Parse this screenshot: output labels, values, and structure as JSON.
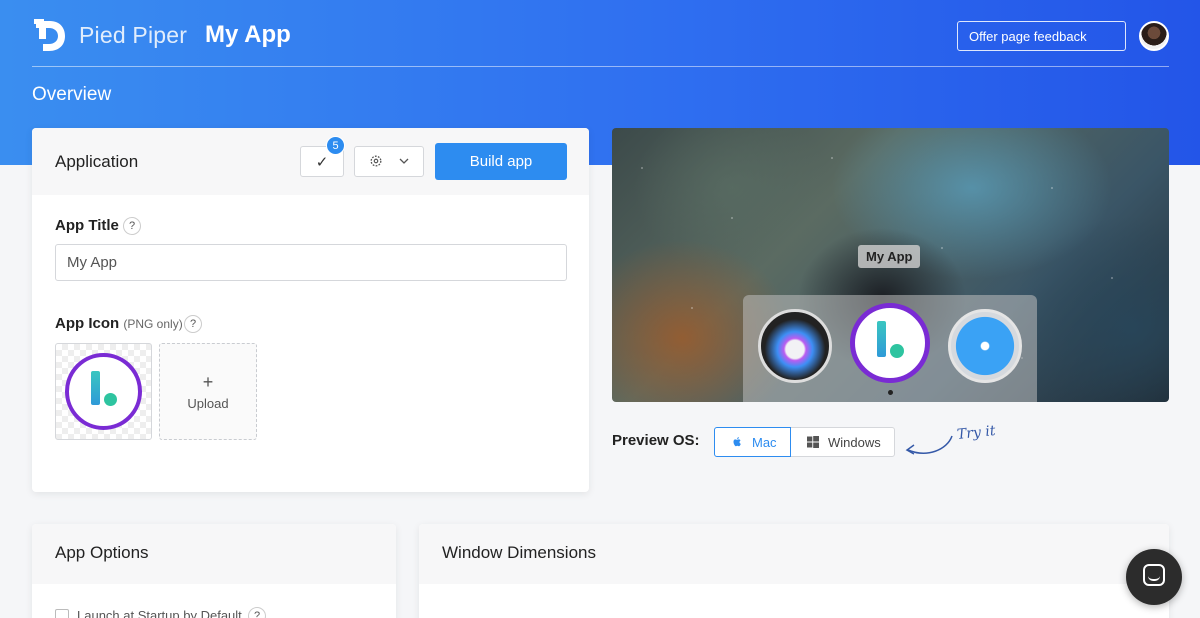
{
  "header": {
    "brand": "Pied Piper",
    "app_name": "My App",
    "feedback_label": "Offer page feedback",
    "page_title": "Overview"
  },
  "application_card": {
    "title": "Application",
    "check_count": "5",
    "build_label": "Build app",
    "app_title_label": "App Title",
    "app_title_value": "My App",
    "app_icon_label": "App Icon",
    "app_icon_hint": "(PNG only)",
    "help": "?",
    "upload_plus": "+",
    "upload_label": "Upload"
  },
  "preview": {
    "tooltip": "My App",
    "label": "Preview OS:",
    "os_options": [
      "Mac",
      "Windows"
    ],
    "selected_os": "Mac",
    "try_it": "Try it"
  },
  "options_card": {
    "title": "App Options",
    "startup_label": "Launch at Startup by Default",
    "help": "?"
  },
  "window_card": {
    "title": "Window Dimensions"
  },
  "colors": {
    "primary": "#2d8cf0",
    "brand_gradient": [
      "#3a8ef0",
      "#2355e8"
    ],
    "icon_ring": "#7a2bd4"
  },
  "icons": [
    "pied-piper-logo",
    "check-icon",
    "gear-icon",
    "chevron-down-icon",
    "apple-icon",
    "windows-icon",
    "chat-icon"
  ]
}
